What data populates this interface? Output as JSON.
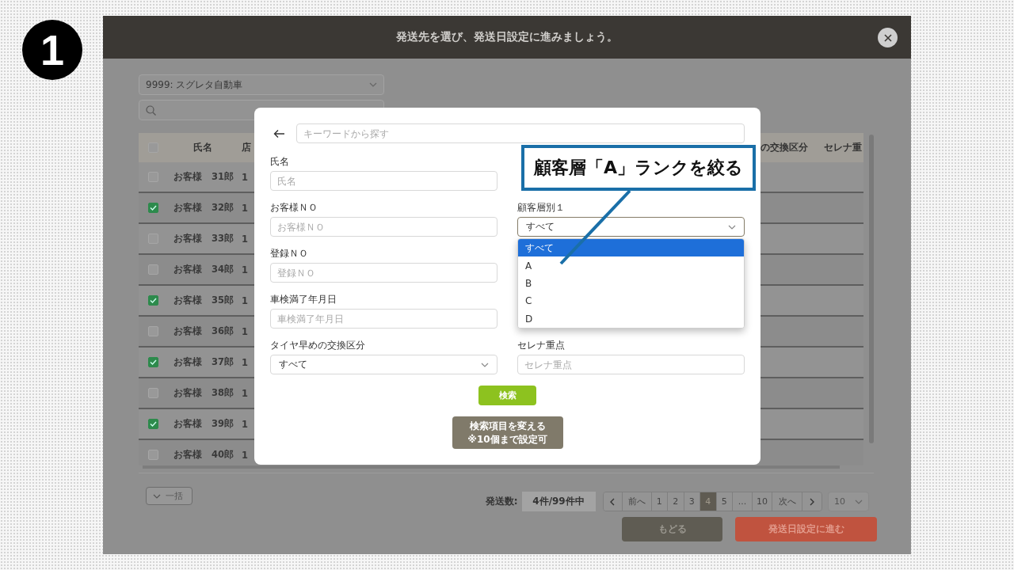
{
  "step_badge": "1",
  "dialog_header": {
    "title": "発送先を選び、発送日設定に進みましょう。"
  },
  "background_page": {
    "dealer_select": {
      "value": "9999: スグレタ自動車"
    },
    "table": {
      "columns": [
        "氏名",
        "店",
        "の交換区分",
        "セレナ重"
      ],
      "all_checked": false,
      "rows": [
        {
          "name": "お客様　31郎",
          "column_3": "1",
          "checked": false
        },
        {
          "name": "お客様　32郎",
          "column_3": "1",
          "checked": true
        },
        {
          "name": "お客様　33郎",
          "column_3": "1",
          "checked": false
        },
        {
          "name": "お客様　34郎",
          "column_3": "1",
          "checked": false
        },
        {
          "name": "お客様　35郎",
          "column_3": "1",
          "checked": true
        },
        {
          "name": "お客様　36郎",
          "column_3": "1",
          "checked": false
        },
        {
          "name": "お客様　37郎",
          "column_3": "1",
          "checked": true
        },
        {
          "name": "お客様　38郎",
          "column_3": "1",
          "checked": false
        },
        {
          "name": "お客様　39郎",
          "column_3": "1",
          "checked": true
        },
        {
          "name": "お客様　40郎",
          "column_3": "1",
          "checked": false
        }
      ]
    },
    "bulk_button": "一括",
    "send_count": {
      "label": "発送数:",
      "value": "4件/99件中"
    },
    "pagination": {
      "prev": "前へ",
      "next": "次へ",
      "pages": [
        {
          "label": "1",
          "selected": false
        },
        {
          "label": "2",
          "selected": false
        },
        {
          "label": "3",
          "selected": false
        },
        {
          "label": "4",
          "selected": true
        },
        {
          "label": "5",
          "selected": false
        },
        {
          "label": "...",
          "selected": false
        },
        {
          "label": "10",
          "selected": false
        }
      ]
    },
    "per_page": "10",
    "buttons": [
      {
        "label": "もどる",
        "kind": "secondary"
      },
      {
        "label": "発送日設定に進む",
        "kind": "primary"
      }
    ]
  },
  "search_modal": {
    "keyword": {
      "placeholder": "キーワードから探す"
    },
    "left_fields": [
      {
        "kind": "text",
        "label": "氏名",
        "placeholder": "氏名"
      },
      {
        "kind": "text",
        "label": "お客様ＮＯ",
        "placeholder": "お客様ＮＯ"
      },
      {
        "kind": "text",
        "label": "登録ＮＯ",
        "placeholder": "登録ＮＯ"
      },
      {
        "kind": "text",
        "label": "車検満了年月日",
        "placeholder": "車検満了年月日"
      },
      {
        "kind": "select",
        "label": "タイヤ早めの交換区分",
        "value": "すべて",
        "open": false
      }
    ],
    "right_fields": [
      {
        "kind": "select",
        "label": "顧客層別１",
        "value": "すべて",
        "open": true,
        "options": [
          {
            "label": "すべて",
            "selected": true
          },
          {
            "label": "A",
            "selected": false
          },
          {
            "label": "B",
            "selected": false
          },
          {
            "label": "C",
            "selected": false
          },
          {
            "label": "D",
            "selected": false
          }
        ]
      },
      {
        "kind": "text",
        "label": "セレナ重点",
        "placeholder": "セレナ重点"
      }
    ],
    "search_button": "検索",
    "change_fields_button": [
      "検索項目を変える",
      "※10個まで設定可"
    ]
  },
  "callout": "顧客層「A」ランクを絞る"
}
